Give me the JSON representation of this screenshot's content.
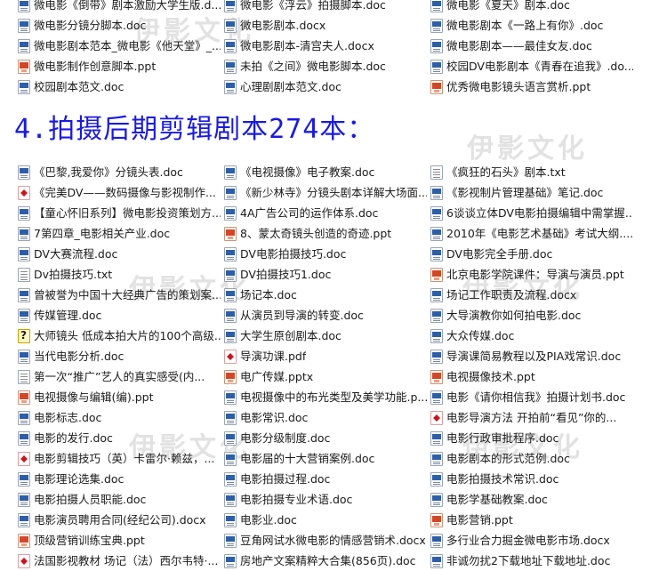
{
  "heading": "4.拍摄后期剪辑剧本274本：",
  "watermark": "伊影文化",
  "top_rows": [
    [
      {
        "icon": "doc",
        "label": "微电影《倒带》剧本激励大学生版.d..."
      },
      {
        "icon": "doc",
        "label": "微电影《浮云》拍摄脚本.doc"
      },
      {
        "icon": "doc",
        "label": "微电影《夏天》剧本.doc"
      }
    ],
    [
      {
        "icon": "doc",
        "label": "微电影分镜分脚本.doc"
      },
      {
        "icon": "doc",
        "label": "微电影剧本.docx"
      },
      {
        "icon": "doc",
        "label": "微电影剧本《一路上有你》.doc"
      }
    ],
    [
      {
        "icon": "doc",
        "label": "微电影剧本范本_微电影《他天堂》_..."
      },
      {
        "icon": "doc",
        "label": "微电影剧本-清宫夫人.docx"
      },
      {
        "icon": "doc",
        "label": "微电影剧本——最佳女友.doc"
      }
    ],
    [
      {
        "icon": "ppt",
        "label": "微电影制作创意脚本.ppt"
      },
      {
        "icon": "doc",
        "label": "未拍《之间》微电影脚本.doc"
      },
      {
        "icon": "doc",
        "label": "校园DV电影剧本《青春在追我》.do..."
      }
    ],
    [
      {
        "icon": "doc",
        "label": "校园剧本范文.doc"
      },
      {
        "icon": "doc",
        "label": "心理剧剧本范文.doc"
      },
      {
        "icon": "ppt",
        "label": "优秀微电影镜头语言赏析.ppt"
      }
    ]
  ],
  "bottom_rows": [
    [
      {
        "icon": "doc",
        "label": "《巴黎,我爱你》分镜头表.doc"
      },
      {
        "icon": "doc",
        "label": "《电视摄像》电子教案.doc"
      },
      {
        "icon": "txt",
        "label": "《疯狂的石头》剧本.txt"
      }
    ],
    [
      {
        "icon": "pdf",
        "label": "《完美DV——数码摄像与影视制作..."
      },
      {
        "icon": "doc",
        "label": "《新少林寺》分镜头剧本详解大场面..."
      },
      {
        "icon": "doc",
        "label": "《影视制片管理基础》笔记.doc"
      }
    ],
    [
      {
        "icon": "doc",
        "label": "【童心怀旧系列】微电影投资策划方..."
      },
      {
        "icon": "doc",
        "label": "4A广告公司的运作体系.doc"
      },
      {
        "icon": "doc",
        "label": "6谈谈立体DV电影拍摄编辑中需掌握..."
      }
    ],
    [
      {
        "icon": "doc",
        "label": "7第四章_电影相关产业.doc"
      },
      {
        "icon": "ppt",
        "label": "8、蒙太奇镜头创造的奇迹.ppt"
      },
      {
        "icon": "doc",
        "label": "2010年《电影艺术基础》考试大纲...."
      }
    ],
    [
      {
        "icon": "doc",
        "label": "DV大赛流程.doc"
      },
      {
        "icon": "doc",
        "label": "DV电影拍摄技巧.doc"
      },
      {
        "icon": "doc",
        "label": "DV电影完全手册.doc"
      }
    ],
    [
      {
        "icon": "txt",
        "label": "Dv拍摄技巧.txt"
      },
      {
        "icon": "doc",
        "label": "DV拍摄技巧1.doc"
      },
      {
        "icon": "ppt",
        "label": "北京电影学院课件：导演与演员.ppt"
      }
    ],
    [
      {
        "icon": "doc",
        "label": "曾被誉为中国十大经典广告的策划案..."
      },
      {
        "icon": "doc",
        "label": "场记本.doc"
      },
      {
        "icon": "doc",
        "label": "场记工作职责及流程.docx"
      }
    ],
    [
      {
        "icon": "doc",
        "label": "传媒管理.doc"
      },
      {
        "icon": "doc",
        "label": "从演员到导演的转变.doc"
      },
      {
        "icon": "doc",
        "label": "大导演教你如何拍电影.doc"
      }
    ],
    [
      {
        "icon": "unk",
        "label": "大师镜头 低成本拍大片的100个高级..."
      },
      {
        "icon": "doc",
        "label": "大学生原创剧本.doc"
      },
      {
        "icon": "doc",
        "label": "大众传媒.doc"
      }
    ],
    [
      {
        "icon": "doc",
        "label": "当代电影分析.doc"
      },
      {
        "icon": "pdf",
        "label": "导演功课.pdf"
      },
      {
        "icon": "doc",
        "label": "导演课简易教程以及PIA戏常识.doc"
      }
    ],
    [
      {
        "icon": "txt",
        "label": "第一次“推广”艺人的真实感受(内..."
      },
      {
        "icon": "ppt",
        "label": "电广传媒.pptx"
      },
      {
        "icon": "ppt",
        "label": "电视摄像技术.ppt"
      }
    ],
    [
      {
        "icon": "ppt",
        "label": "电视摄像与编辑(编).ppt"
      },
      {
        "icon": "doc",
        "label": "电视摄像中的布光类型及美学功能.p..."
      },
      {
        "icon": "doc",
        "label": "电影《请你相信我》拍摄计划书.doc"
      }
    ],
    [
      {
        "icon": "doc",
        "label": "电影标志.doc"
      },
      {
        "icon": "doc",
        "label": "电影常识.doc"
      },
      {
        "icon": "pdf",
        "label": "电影导演方法 开拍前“看见”你的..."
      }
    ],
    [
      {
        "icon": "doc",
        "label": "电影的发行.doc"
      },
      {
        "icon": "doc",
        "label": "电影分级制度.doc"
      },
      {
        "icon": "doc",
        "label": "电影行政审批程序.doc"
      }
    ],
    [
      {
        "icon": "pdf",
        "label": "电影剪辑技巧（英）卡雷尔·赖兹，..."
      },
      {
        "icon": "doc",
        "label": "电影届的十大营销案例.doc"
      },
      {
        "icon": "doc",
        "label": "电影剧本的形式范例.doc"
      }
    ],
    [
      {
        "icon": "doc",
        "label": "电影理论选集.doc"
      },
      {
        "icon": "doc",
        "label": "电影拍摄过程.doc"
      },
      {
        "icon": "doc",
        "label": "电影拍摄技术常识.doc"
      }
    ],
    [
      {
        "icon": "doc",
        "label": "电影拍摄人员职能.doc"
      },
      {
        "icon": "doc",
        "label": "电影拍摄专业术语.doc"
      },
      {
        "icon": "doc",
        "label": "电影学基础教案.doc"
      }
    ],
    [
      {
        "icon": "doc",
        "label": "电影演员聘用合同(经纪公司).docx"
      },
      {
        "icon": "doc",
        "label": "电影业.doc"
      },
      {
        "icon": "ppt",
        "label": "电影营销.ppt"
      }
    ],
    [
      {
        "icon": "ppt",
        "label": "顶级营销训练宝典.ppt"
      },
      {
        "icon": "doc",
        "label": "豆角网试水微电影的情感营销术.docx"
      },
      {
        "icon": "doc",
        "label": "多行业合力掘金微电影市场.docx"
      }
    ],
    [
      {
        "icon": "pdf",
        "label": "法国影视教材 场记（法）西尔韦特·..."
      },
      {
        "icon": "doc",
        "label": "房地产文案精粹大合集(856页).doc"
      },
      {
        "icon": "doc",
        "label": "非诚勿扰2下载地址下载地址.doc"
      }
    ]
  ]
}
